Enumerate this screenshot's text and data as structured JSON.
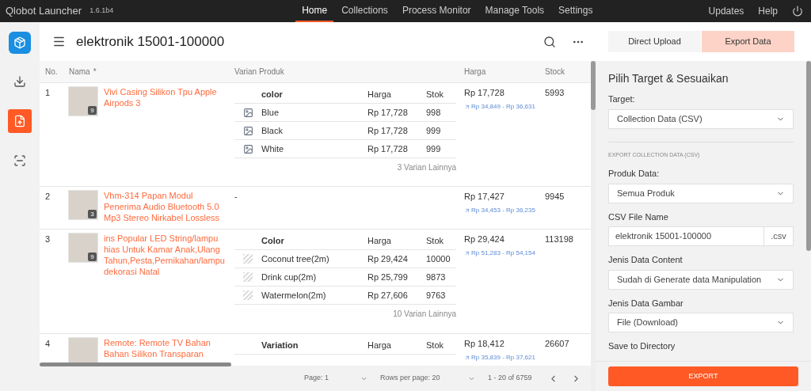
{
  "app": {
    "title": "Qlobot Launcher",
    "version": "1.6.1b4"
  },
  "nav": [
    {
      "label": "Home",
      "selected": true
    },
    {
      "label": "Collections",
      "selected": false
    },
    {
      "label": "Process Monitor",
      "selected": false
    },
    {
      "label": "Manage Tools",
      "selected": false
    },
    {
      "label": "Settings",
      "selected": false
    }
  ],
  "nav_right": [
    "Updates",
    "Help"
  ],
  "sidebar": [
    {
      "kind": "download",
      "selected": false
    },
    {
      "kind": "export",
      "selected": true
    },
    {
      "kind": "scan",
      "selected": false
    }
  ],
  "header": {
    "title": "elektronik 15001-100000",
    "buttons": [
      {
        "label": "Direct Upload",
        "kind": "plain"
      },
      {
        "label": "Export Data",
        "kind": "accent"
      }
    ]
  },
  "table": {
    "columns": [
      "No.",
      "Nama",
      "Varian Produk",
      "Harga",
      "Stock"
    ],
    "sort_mark": "*",
    "rows": [
      {
        "no": "1",
        "name": "Vivi Casing Silikon Tpu Apple Airpods 3",
        "photo_count": "9",
        "price": "Rp 17,728",
        "price_range": "Rp 34,849 - Rp 36,631",
        "stock": "5993",
        "variants": {
          "header": [
            "color",
            "Harga",
            "Stok"
          ],
          "kind": "image",
          "items": [
            [
              "Blue",
              "Rp 17,728",
              "998"
            ],
            [
              "Black",
              "Rp 17,728",
              "999"
            ],
            [
              "White",
              "Rp 17,728",
              "999"
            ]
          ],
          "more": "3 Varian Lainnya"
        }
      },
      {
        "no": "2",
        "name": "Vhm-314 Papan Modul Penerima Audio Bluetooth 5.0 Mp3 Stereo Nirkabel Lossless",
        "photo_count": "3",
        "price": "Rp 17,427",
        "price_range": "Rp 34,453 - Rp 36,235",
        "stock": "9945",
        "no_variants": "-"
      },
      {
        "no": "3",
        "name": "ins Popular LED String/lampu hias Untuk Kamar Anak,Ulang Tahun,Pesta,Pernikahan/lampu dekorasi Natal",
        "photo_count": "9",
        "price": "Rp 29,424",
        "price_range": "Rp 51,283 - Rp 54,154",
        "stock": "113198",
        "variants": {
          "header": [
            "Color",
            "Harga",
            "Stok"
          ],
          "kind": "hatched",
          "items": [
            [
              "Coconut tree(2m)",
              "Rp 29,424",
              "10000"
            ],
            [
              "Drink cup(2m)",
              "Rp 25,799",
              "9873"
            ],
            [
              "Watermelon(2m)",
              "Rp 27,606",
              "9763"
            ]
          ],
          "more": "10 Varian Lainnya"
        }
      },
      {
        "no": "4",
        "name": "Remote: Remote TV Bahan Bahan Silikon Transparan",
        "price": "Rp 18,412",
        "price_range": "Rp 35,839 - Rp 37,621",
        "stock": "26607",
        "variants": {
          "header": [
            "Variation",
            "Harga",
            "Stok"
          ]
        }
      }
    ]
  },
  "pagination": {
    "page": "Page: 1",
    "rows_per_page": "Rows per page: 20",
    "range": "1 - 20 of 6759"
  },
  "export_panel": {
    "title": "Pilih Target & Sesuaikan",
    "target": {
      "label": "Target:",
      "value": "Collection Data (CSV)"
    },
    "section": "EXPORT COLLECTION DATA (CSV)",
    "fields": [
      {
        "kind": "select",
        "label": "Produk Data:",
        "value": "Semua Produk"
      },
      {
        "kind": "text",
        "label": "CSV File Name",
        "value": "elektronik 15001-100000",
        "suffix": ".csv"
      },
      {
        "kind": "select",
        "label": "Jenis Data Content",
        "value": "Sudah di Generate data Manipulation"
      },
      {
        "kind": "select",
        "label": "Jenis Data Gambar",
        "value": "File (Download)"
      },
      {
        "kind": "label",
        "label": "Save to Directory"
      }
    ],
    "button": "EXPORT"
  }
}
